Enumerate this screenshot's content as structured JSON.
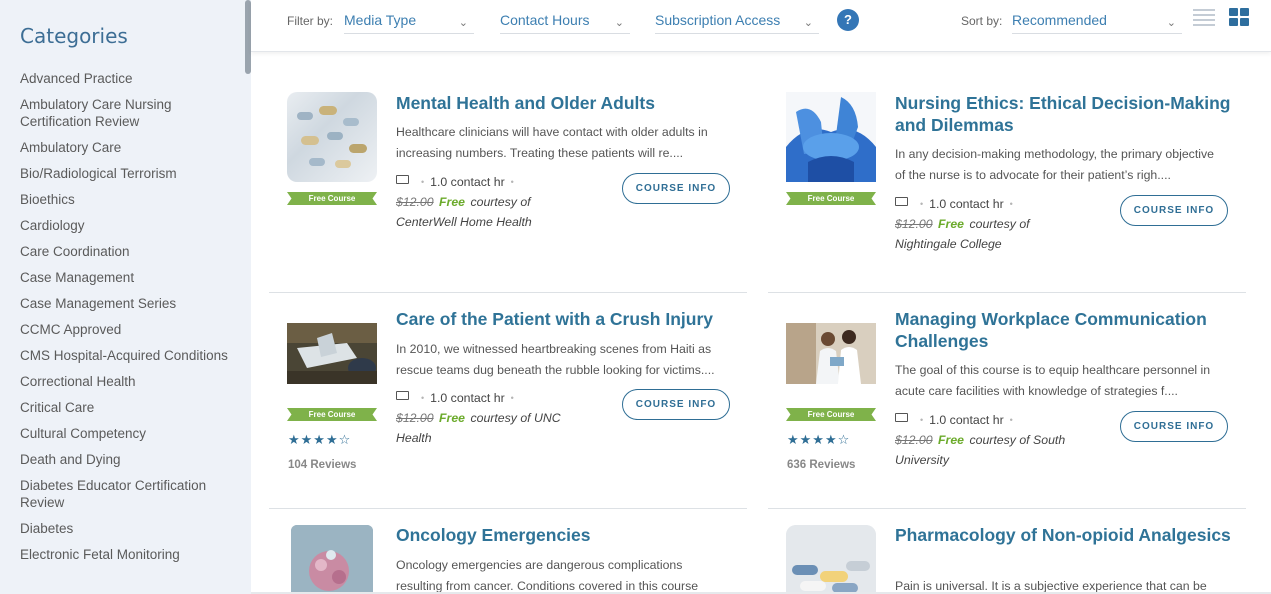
{
  "sidebar": {
    "title": "Categories",
    "items": [
      "Advanced Practice",
      "Ambulatory Care Nursing Certification Review",
      "Ambulatory Care",
      "Bio/Radiological Terrorism",
      "Bioethics",
      "Cardiology",
      "Care Coordination",
      "Case Management",
      "Case Management Series",
      "CCMC Approved",
      "CMS Hospital-Acquired Conditions",
      "Correctional Health",
      "Critical Care",
      "Cultural Competency",
      "Death and Dying",
      "Diabetes Educator Certification Review",
      "Diabetes",
      "Electronic Fetal Monitoring"
    ]
  },
  "filters": {
    "filter_label": "Filter by:",
    "media_type": "Media Type",
    "contact_hours": "Contact Hours",
    "subscription_access": "Subscription Access",
    "help": "?",
    "sort_label": "Sort by:",
    "sort_value": "Recommended"
  },
  "common": {
    "free_ribbon": "Free Course",
    "button_label": "COURSE INFO",
    "contact": "1.0 contact hr",
    "old_price": "$12.00",
    "free_word": "Free",
    "courtesy": "courtesy of",
    "dot": "•"
  },
  "courses": [
    {
      "title": "Mental Health and Older Adults",
      "description": "Healthcare clinicians will have contact with older adults in increasing numbers. Treating these patients will re....",
      "provider": "CenterWell Home Health",
      "stars": "",
      "reviews": ""
    },
    {
      "title": "Nursing Ethics: Ethical Decision-Making and Dilemmas",
      "description": "In any decision-making methodology, the primary objective of the nurse is to advocate for their patient’s righ....",
      "provider": "Nightingale College",
      "stars": "",
      "reviews": ""
    },
    {
      "title": "Care of the Patient with a Crush Injury",
      "description": "In 2010, we witnessed heartbreaking scenes from Haiti as rescue teams dug beneath the rubble looking for victims....",
      "provider": "UNC Health",
      "stars": "★★★★☆",
      "reviews": "104 Reviews"
    },
    {
      "title": "Managing Workplace Communication Challenges",
      "description": "The goal of this course is to equip healthcare personnel in acute care facilities with knowledge of strategies f....",
      "provider": "South University",
      "stars": "★★★★☆",
      "reviews": "636 Reviews"
    },
    {
      "title": "Oncology Emergencies",
      "description": "Oncology emergencies are dangerous complications resulting from cancer. Conditions covered in this course",
      "provider": "",
      "stars": "",
      "reviews": ""
    },
    {
      "title": "Pharmacology of Non-opioid Analgesics",
      "description": "Pain is universal. It is a subjective experience that can be",
      "provider": "",
      "stars": "",
      "reviews": ""
    }
  ]
}
